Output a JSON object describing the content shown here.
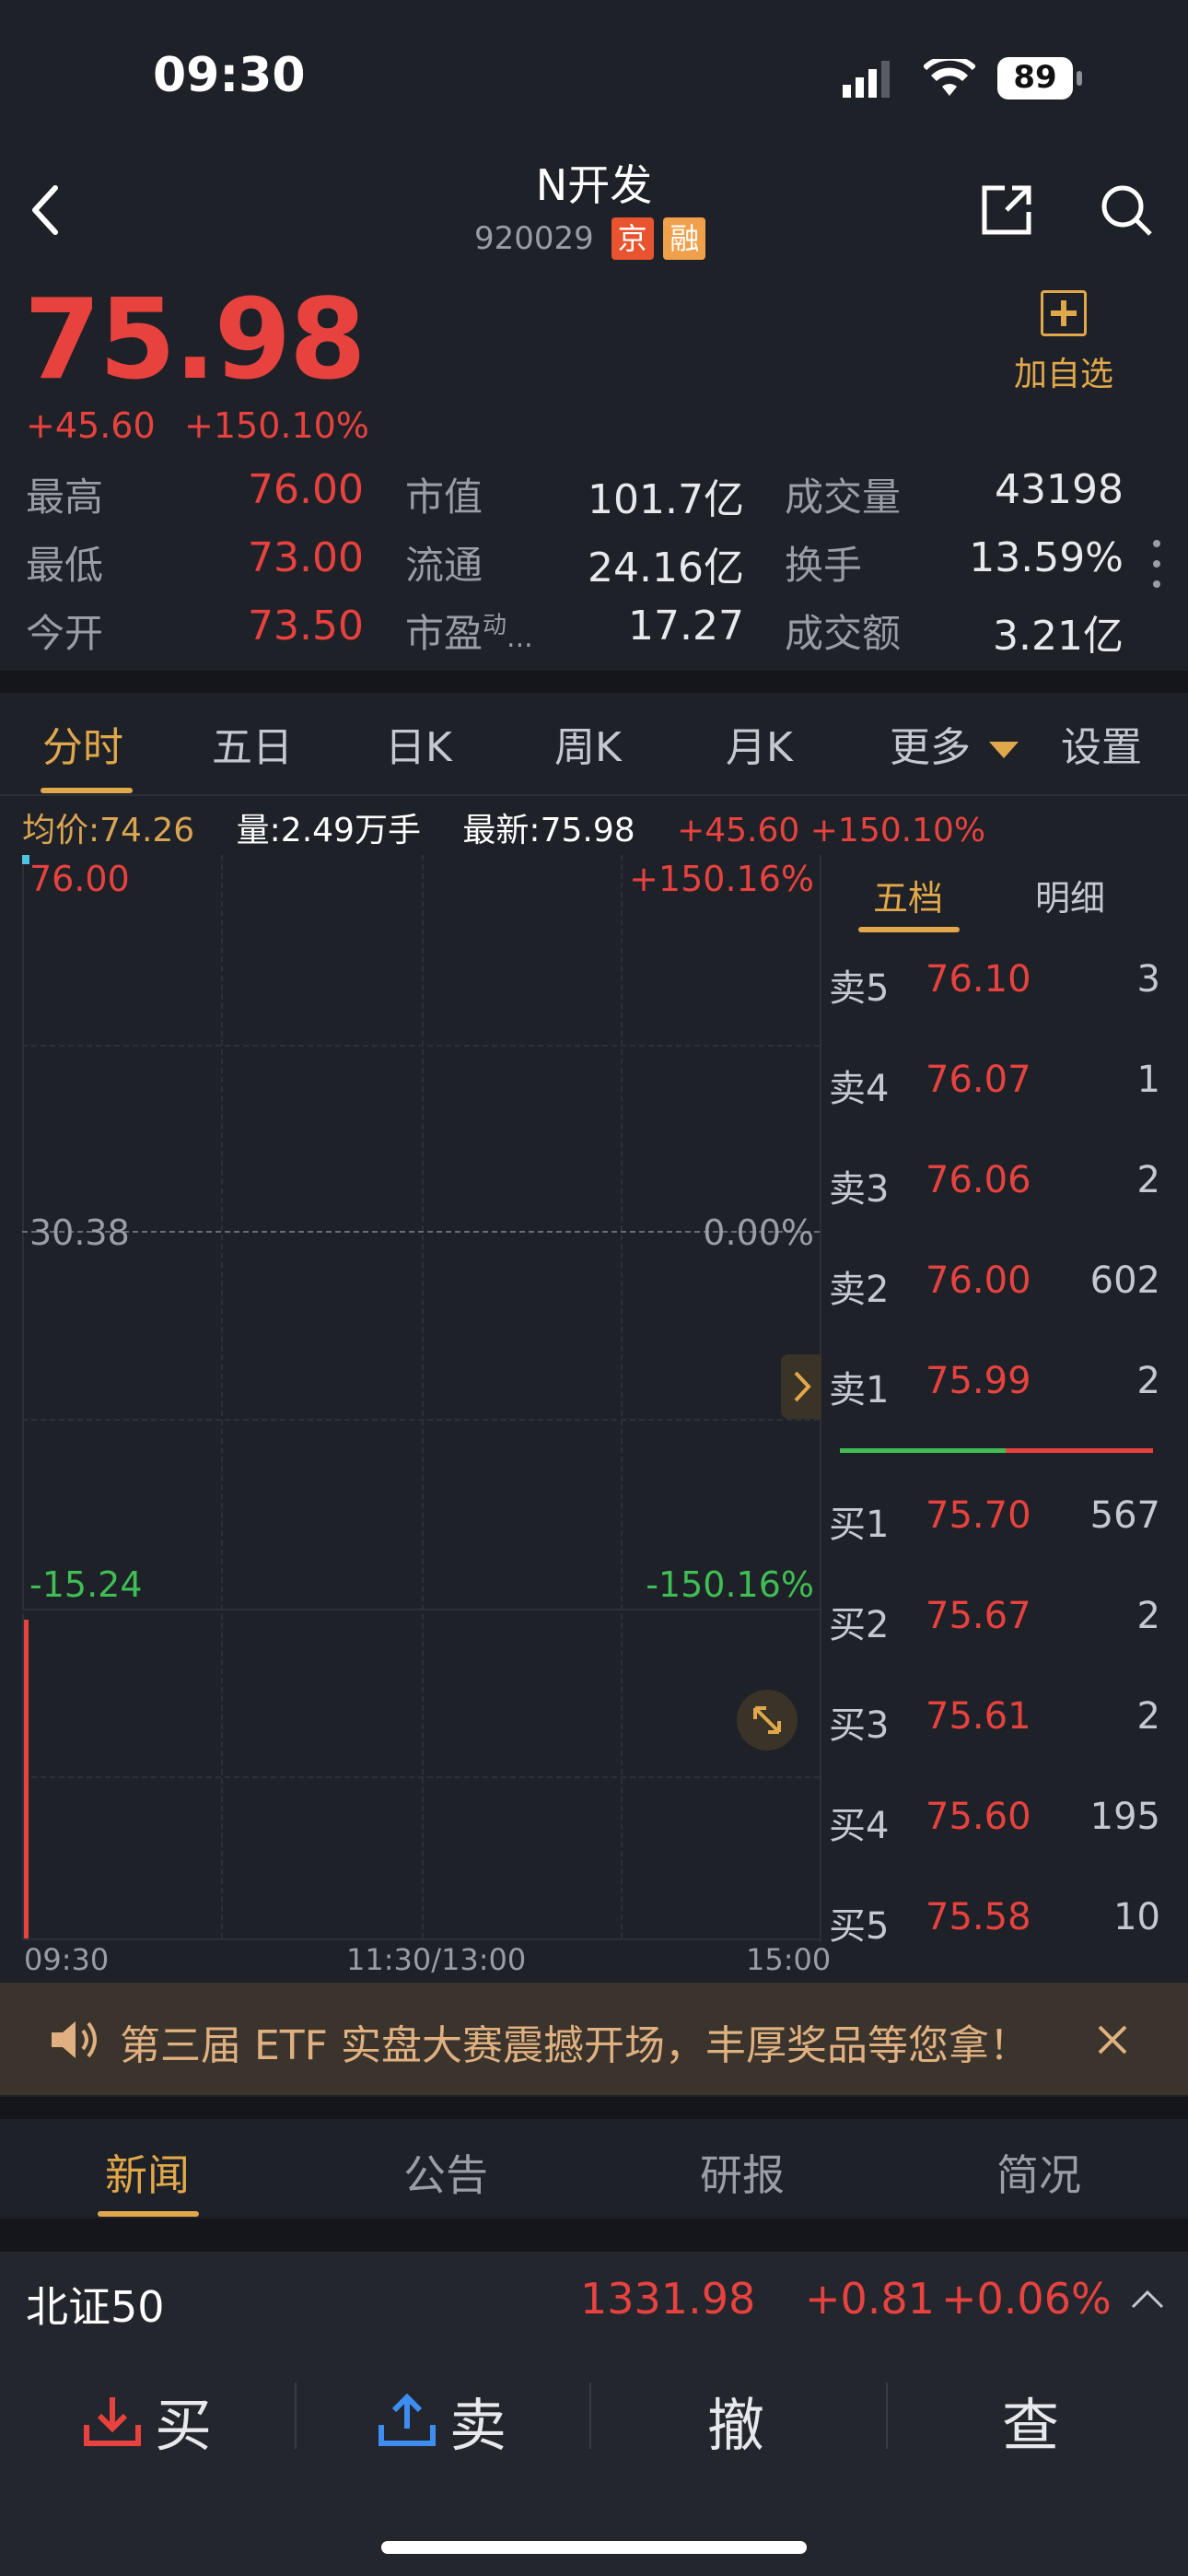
{
  "status_bar": {
    "time": "09:30",
    "battery": "89"
  },
  "header": {
    "title": "N开发",
    "code": "920029",
    "tag_exchange": "京",
    "tag_margin": "融",
    "fav_label": "加自选"
  },
  "quote": {
    "price": "75.98",
    "change": "+45.60",
    "change_pct": "+150.10%",
    "stats": [
      {
        "label": "最高",
        "value": "76.00"
      },
      {
        "label": "市值",
        "value": "101.7亿"
      },
      {
        "label": "成交量",
        "value": "43198"
      },
      {
        "label": "最低",
        "value": "73.00"
      },
      {
        "label": "流通",
        "value": "24.16亿"
      },
      {
        "label": "换手",
        "value": "13.59%"
      },
      {
        "label": "今开",
        "value": "73.50"
      },
      {
        "label": "市盈",
        "label_sup": "动",
        "label_suffix": "...",
        "value": "17.27"
      },
      {
        "label": "成交额",
        "value": "3.21亿"
      }
    ]
  },
  "chart_tabs": [
    "分时",
    "五日",
    "日K",
    "周K",
    "月K",
    "更多",
    "设置"
  ],
  "info_bar": {
    "avg_label": "均价:",
    "avg_value": "74.26",
    "vol_label": "量:",
    "vol_value": "2.49万手",
    "latest_label": "最新:",
    "latest_value": "75.98",
    "chg": "+45.60",
    "chg_pct": "+150.10%"
  },
  "chart": {
    "top_price": "76.00",
    "top_pct": "+150.16%",
    "mid_price": "30.38",
    "mid_pct": "0.00%",
    "bottom_price": "-15.24",
    "bottom_pct": "-150.16%",
    "time_start": "09:30",
    "time_mid": "11:30/13:00",
    "time_end": "15:00"
  },
  "book_tabs": [
    "五档",
    "明细"
  ],
  "order_book": {
    "sells": [
      {
        "label": "卖5",
        "price": "76.10",
        "qty": "3"
      },
      {
        "label": "卖4",
        "price": "76.07",
        "qty": "1"
      },
      {
        "label": "卖3",
        "price": "76.06",
        "qty": "2"
      },
      {
        "label": "卖2",
        "price": "76.00",
        "qty": "602"
      },
      {
        "label": "卖1",
        "price": "75.99",
        "qty": "2"
      }
    ],
    "buys": [
      {
        "label": "买1",
        "price": "75.70",
        "qty": "567"
      },
      {
        "label": "买2",
        "price": "75.67",
        "qty": "2"
      },
      {
        "label": "买3",
        "price": "75.61",
        "qty": "2"
      },
      {
        "label": "买4",
        "price": "75.60",
        "qty": "195"
      },
      {
        "label": "买5",
        "price": "75.58",
        "qty": "10"
      }
    ]
  },
  "banner": {
    "text": "第三届 ETF 实盘大赛震撼开场，丰厚奖品等您拿！"
  },
  "news_tabs": [
    "新闻",
    "公告",
    "研报",
    "简况"
  ],
  "index_bar": {
    "name": "北证50",
    "value": "1331.98",
    "change": "+0.81",
    "change_pct": "+0.06%"
  },
  "actions": {
    "buy": "买",
    "sell": "卖",
    "cancel": "撤",
    "query": "查"
  },
  "colors": {
    "up": "#e8423f",
    "down": "#3fbe55",
    "accent": "#e0a84a",
    "bg": "#1f2128"
  }
}
